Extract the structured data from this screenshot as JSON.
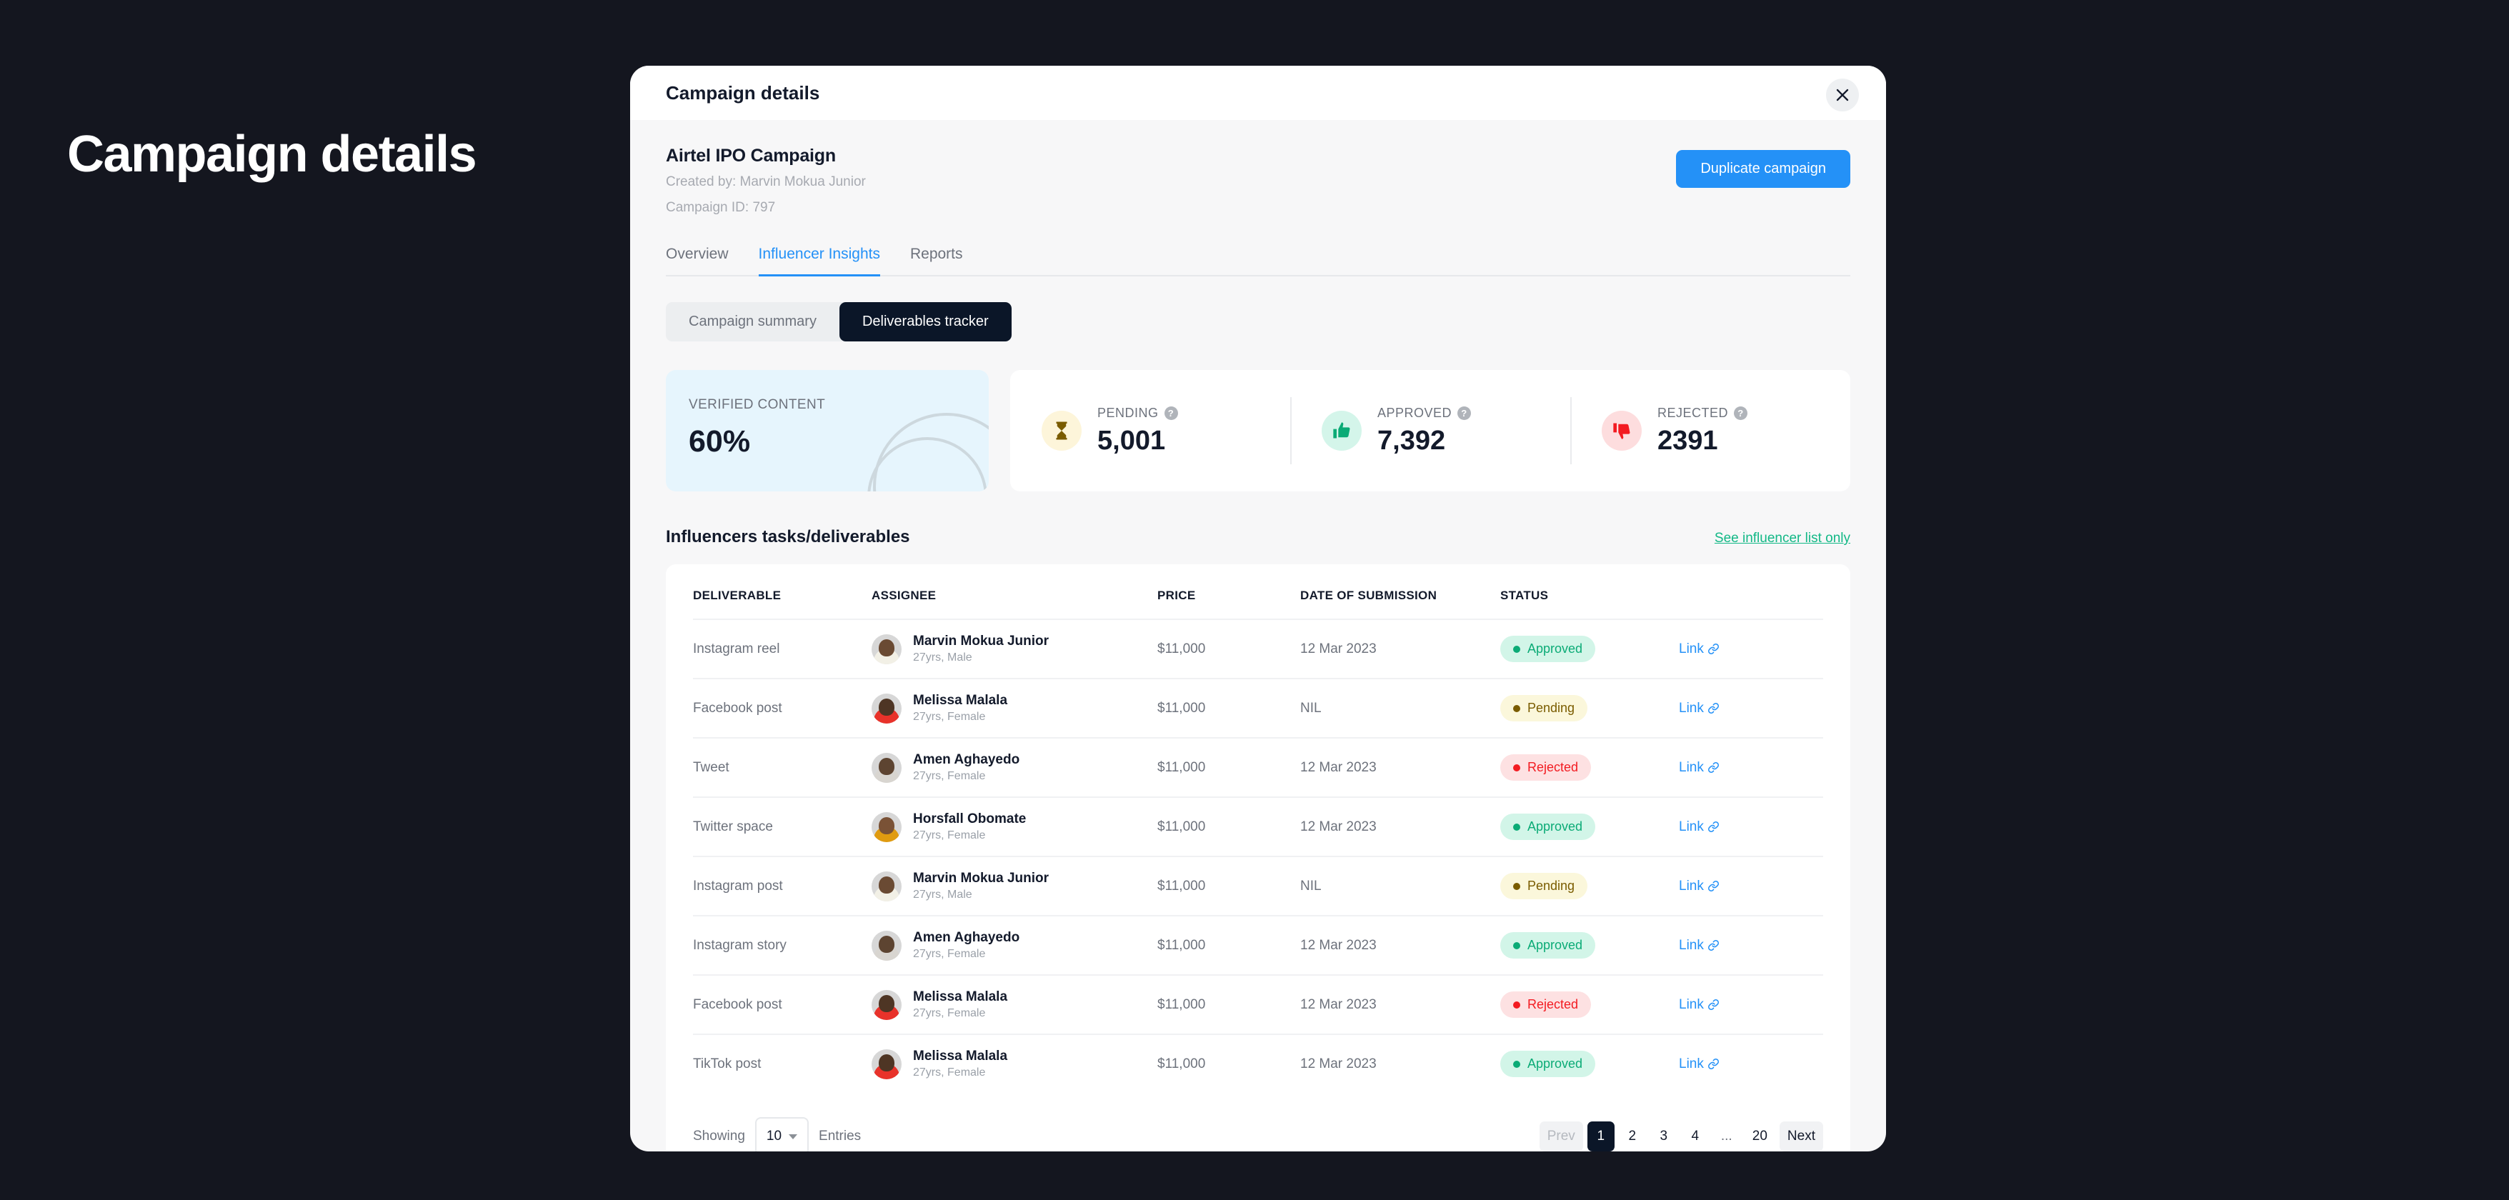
{
  "page": {
    "heading": "Campaign details",
    "background": "#14161f"
  },
  "modal": {
    "title": "Campaign details",
    "close_icon": "close-icon",
    "campaign": {
      "name": "Airtel IPO Campaign",
      "created_by": "Created by: Marvin Mokua Junior",
      "campaign_id": "Campaign ID: 797",
      "duplicate_label": "Duplicate campaign",
      "accent": "#2491f7"
    },
    "tabs": [
      {
        "label": "Overview",
        "active": false
      },
      {
        "label": "Influencer Insights",
        "active": true
      },
      {
        "label": "Reports",
        "active": false
      }
    ],
    "segmented": [
      {
        "label": "Campaign summary",
        "active": false
      },
      {
        "label": "Deliverables tracker",
        "active": true
      }
    ],
    "stats": {
      "verified": {
        "label": "VERIFIED CONTENT",
        "value": "60%",
        "bg": "#e6f5fd"
      },
      "metrics": [
        {
          "label": "PENDING",
          "value": "5,001",
          "icon": "hourglass-icon",
          "icon_bg": "#fdf5da",
          "color": "#7a5c00",
          "help": "?"
        },
        {
          "label": "APPROVED",
          "value": "7,392",
          "icon": "thumbs-up-icon",
          "icon_bg": "#d4f5ea",
          "color": "#0bab76",
          "help": "?"
        },
        {
          "label": "REJECTED",
          "value": "2391",
          "icon": "thumbs-down-icon",
          "icon_bg": "#fdddde",
          "color": "#f31b21",
          "help": "?"
        }
      ]
    },
    "table_section": {
      "title": "Influencers tasks/deliverables",
      "link_label": "See influencer list only",
      "link_color": "#12b886",
      "columns": [
        "DELIVERABLE",
        "ASSIGNEE",
        "PRICE",
        "DATE OF SUBMISSION",
        "STATUS",
        ""
      ],
      "rows": [
        {
          "deliverable": "Instagram reel",
          "name": "Marvin Mokua Junior",
          "meta": "27yrs, Male",
          "price": "$11,000",
          "date": "12 Mar 2023",
          "status": "Approved",
          "status_key": "approved",
          "link": "Link",
          "skin": "#6a4a33",
          "shirt": "#f2f0e6"
        },
        {
          "deliverable": "Facebook post",
          "name": "Melissa Malala",
          "meta": "27yrs, Female",
          "price": "$11,000",
          "date": "NIL",
          "status": "Pending",
          "status_key": "pending",
          "link": "Link",
          "skin": "#4e3524",
          "shirt": "#e8322a"
        },
        {
          "deliverable": "Tweet",
          "name": "Amen Aghayedo",
          "meta": "27yrs, Female",
          "price": "$11,000",
          "date": "12 Mar 2023",
          "status": "Rejected",
          "status_key": "rejected",
          "link": "Link",
          "skin": "#5d4431",
          "shirt": "#d8d5d0"
        },
        {
          "deliverable": "Twitter space",
          "name": "Horsfall Obomate",
          "meta": "27yrs, Female",
          "price": "$11,000",
          "date": "12 Mar 2023",
          "status": "Approved",
          "status_key": "approved",
          "link": "Link",
          "skin": "#7a5236",
          "shirt": "#e09b10"
        },
        {
          "deliverable": "Instagram post",
          "name": "Marvin Mokua Junior",
          "meta": "27yrs, Male",
          "price": "$11,000",
          "date": "NIL",
          "status": "Pending",
          "status_key": "pending",
          "link": "Link",
          "skin": "#6a4a33",
          "shirt": "#f2f0e6"
        },
        {
          "deliverable": "Instagram story",
          "name": "Amen Aghayedo",
          "meta": "27yrs, Female",
          "price": "$11,000",
          "date": "12 Mar 2023",
          "status": "Approved",
          "status_key": "approved",
          "link": "Link",
          "skin": "#5d4431",
          "shirt": "#d8d5d0"
        },
        {
          "deliverable": "Facebook post",
          "name": "Melissa Malala",
          "meta": "27yrs, Female",
          "price": "$11,000",
          "date": "12 Mar 2023",
          "status": "Rejected",
          "status_key": "rejected",
          "link": "Link",
          "skin": "#4e3524",
          "shirt": "#e8322a"
        },
        {
          "deliverable": "TikTok post",
          "name": "Melissa Malala",
          "meta": "27yrs, Female",
          "price": "$11,000",
          "date": "12 Mar 2023",
          "status": "Approved",
          "status_key": "approved",
          "link": "Link",
          "skin": "#4e3524",
          "shirt": "#e8322a"
        }
      ]
    },
    "pagination": {
      "showing_label": "Showing",
      "entries_label": "Entries",
      "per_page": "10",
      "prev_label": "Prev",
      "next_label": "Next",
      "pages": [
        "1",
        "2",
        "3",
        "4",
        "...",
        "20"
      ],
      "current_page": "1"
    }
  }
}
